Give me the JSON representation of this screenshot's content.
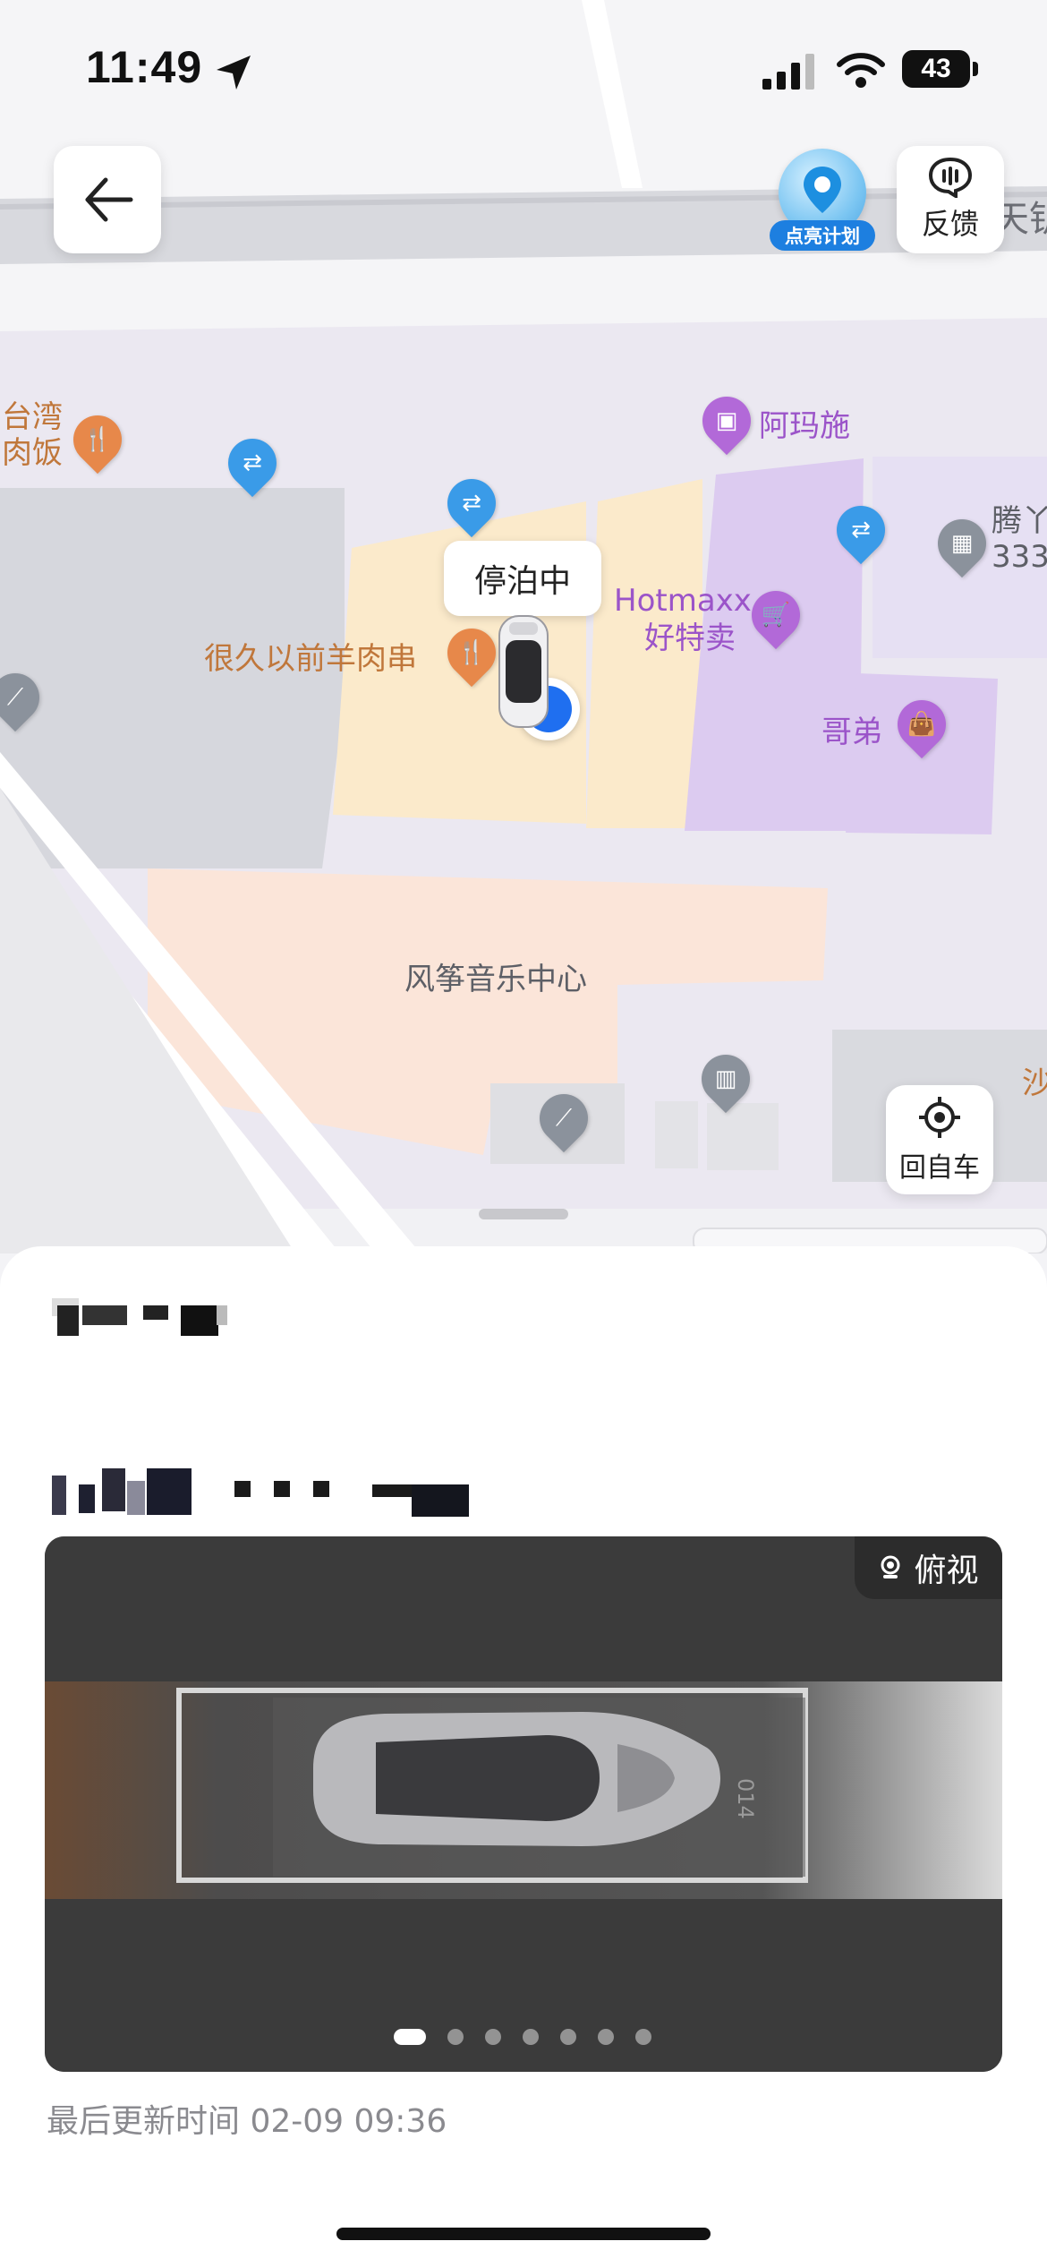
{
  "status_bar": {
    "time": "11:49",
    "battery": "43"
  },
  "map": {
    "road_label_partial": "天钥",
    "pois": {
      "taiwan_line1": "台湾",
      "taiwan_line2": "肉饭",
      "amashi": "阿玛施",
      "teng_line1": "腾丫",
      "teng_line2": "333",
      "hotmaxx_line1": "Hotmaxx",
      "hotmaxx_line2": "好特卖",
      "lamb": "很久以前羊肉串",
      "gedi": "哥弟",
      "kite": "风筝音乐中心",
      "sha": "沙"
    },
    "car_status_bubble": "停泊中"
  },
  "buttons": {
    "back": "back",
    "light_plan": "点亮计划",
    "feedback": "反馈",
    "return_to_car": "回自车"
  },
  "sheet": {
    "camera_badge": "俯视",
    "camera_plate_text": "014",
    "last_updated": "最后更新时间 02-09 09:36",
    "pager_total": 7,
    "pager_active": 1
  }
}
